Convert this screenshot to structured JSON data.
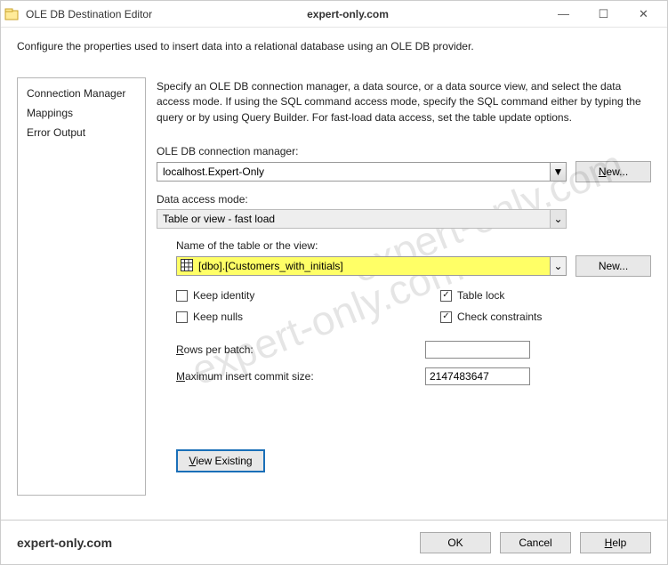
{
  "titlebar": {
    "title": "OLE DB Destination Editor",
    "center_brand": "expert-only.com"
  },
  "description": "Configure the properties used to insert data into a relational database using an OLE DB provider.",
  "sidebar": {
    "items": [
      {
        "label": "Connection Manager"
      },
      {
        "label": "Mappings"
      },
      {
        "label": "Error Output"
      }
    ]
  },
  "content": {
    "instructions": "Specify an OLE DB connection manager, a data source, or a data source view, and select the data access mode. If using the SQL command access mode, specify the SQL command either by typing the query or by using Query Builder. For fast-load data access, set the table update options.",
    "conn_label": "OLE DB connection manager:",
    "conn_value": "localhost.Expert-Only",
    "conn_new_btn": "New...",
    "mode_label": "Data access mode:",
    "mode_value": "Table or view - fast load",
    "table_label": "Name of the table or the view:",
    "table_value": "[dbo].[Customers_with_initials]",
    "table_new_btn": "New...",
    "checks": {
      "keep_identity": "Keep identity",
      "table_lock": "Table lock",
      "keep_nulls": "Keep nulls",
      "check_constraints": "Check constraints"
    },
    "rows_per_batch_label": "Rows per batch:",
    "rows_per_batch_value": "",
    "max_commit_label": "Maximum insert commit size:",
    "max_commit_value": "2147483647",
    "view_existing_btn": "View Existing"
  },
  "footer": {
    "brand": "expert-only.com",
    "ok": "OK",
    "cancel": "Cancel",
    "help": "Help"
  },
  "watermark": "expert-only.com"
}
